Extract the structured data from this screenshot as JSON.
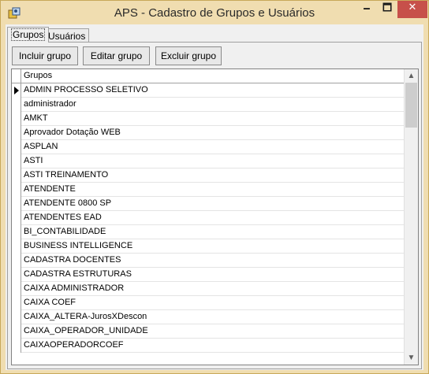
{
  "window": {
    "title": "APS - Cadastro de Grupos e Usuários",
    "controls": {
      "minimize": "🗕",
      "maximize": "🗖",
      "close": "✕"
    },
    "accent_color": "#f0ddb0",
    "close_color": "#c7504a"
  },
  "tabs": [
    {
      "label": "Grupos",
      "selected": true
    },
    {
      "label": "Usuários",
      "selected": false
    }
  ],
  "toolbar": {
    "include_label": "Incluir grupo",
    "edit_label": "Editar grupo",
    "delete_label": "Excluir grupo"
  },
  "grid": {
    "column_header": "Grupos",
    "selected_index": 0,
    "rows": [
      "ADMIN PROCESSO SELETIVO",
      "administrador",
      "AMKT",
      "Aprovador Dotação WEB",
      "ASPLAN",
      "ASTI",
      "ASTI TREINAMENTO",
      "ATENDENTE",
      "ATENDENTE 0800 SP",
      "ATENDENTES EAD",
      "BI_CONTABILIDADE",
      "BUSINESS INTELLIGENCE",
      "CADASTRA DOCENTES",
      "CADASTRA ESTRUTURAS",
      "CAIXA ADMINISTRADOR",
      "CAIXA COEF",
      "CAIXA_ALTERA-JurosXDescon",
      "CAIXA_OPERADOR_UNIDADE",
      "CAIXAOPERADORCOEF"
    ],
    "scroll_position": 0
  }
}
